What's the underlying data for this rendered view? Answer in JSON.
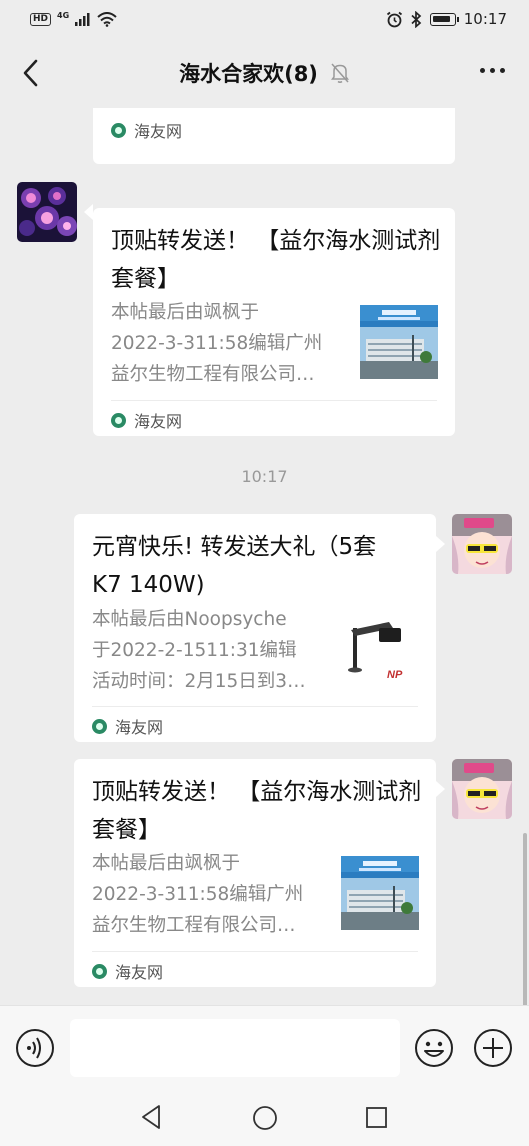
{
  "status_bar": {
    "hd": "HD",
    "network": "4G",
    "time": "10:17"
  },
  "header": {
    "title": "海水合家欢(8)",
    "back_icon": "chevron-left-icon",
    "mute_icon": "bell-off-icon",
    "more_icon": "more-dots-icon"
  },
  "messages": [
    {
      "id": "msg0",
      "side": "left",
      "partial": true,
      "source": "海友网"
    },
    {
      "id": "msg1",
      "side": "left",
      "title": "顶贴转发送！ 【益尔海水测试剂套餐】",
      "desc_lines": [
        "本帖最后由飒枫于",
        "2022-3-311:58编辑广州",
        "益尔生物工程有限公司…"
      ],
      "source": "海友网",
      "thumb": "building-photo"
    },
    {
      "id": "msg2",
      "side": "right",
      "time_before": "10:17",
      "title": "元宵快乐! 转发送大礼（5套 K7  140W)",
      "desc_lines": [
        "本帖最后由Noopsyche",
        "于2022-2-1511:31编辑",
        "活动时间：2月15日到3…"
      ],
      "source": "海友网",
      "thumb": "aquarium-light-photo",
      "thumb_text": "NP"
    },
    {
      "id": "msg3",
      "side": "right",
      "title": "顶贴转发送！ 【益尔海水测试剂套餐】",
      "desc_lines": [
        "本帖最后由飒枫于",
        "2022-3-311:58编辑广州",
        "益尔生物工程有限公司…"
      ],
      "source": "海友网",
      "thumb": "building-photo"
    }
  ],
  "input_bar": {
    "voice_icon": "voice-icon",
    "input_value": "",
    "emoji_icon": "emoji-icon",
    "plus_icon": "plus-icon"
  },
  "nav_bar": {
    "back_icon": "triangle-back-icon",
    "home_icon": "circle-home-icon",
    "recent_icon": "square-recent-icon"
  },
  "colors": {
    "background": "#ededed",
    "card": "#ffffff",
    "source_icon": "#2a8a64"
  }
}
